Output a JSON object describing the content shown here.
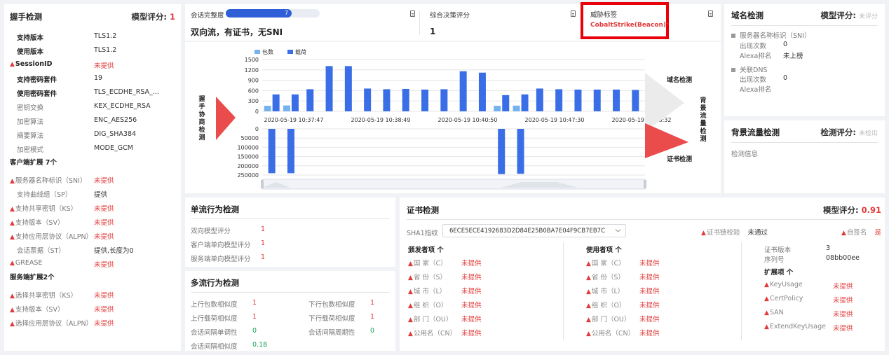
{
  "handshake": {
    "title": "握手检测",
    "score_label": "模型评分:",
    "score_value": "1",
    "rows": [
      {
        "label": "支持版本",
        "value": "TLS1.2",
        "style": "bold",
        "warn": false
      },
      {
        "label": "使用版本",
        "value": "TLS1.2",
        "style": "bold",
        "warn": false
      },
      {
        "label": "SessionID",
        "value": "未提供",
        "style": "bold",
        "warn": true
      },
      {
        "label": "支持密码套件",
        "value": "19",
        "style": "bold",
        "warn": false
      },
      {
        "label": "使用密码套件",
        "value": "TLS_ECDHE_RSA_...",
        "style": "bold",
        "warn": false
      },
      {
        "label": "密钥交换",
        "value": "KEX_ECDHE_RSA",
        "style": "light",
        "warn": false
      },
      {
        "label": "加密算法",
        "value": "ENC_AES256",
        "style": "light",
        "warn": false
      },
      {
        "label": "摘要算法",
        "value": "DIG_SHA384",
        "style": "light",
        "warn": false
      },
      {
        "label": "加密模式",
        "value": "MODE_GCM",
        "style": "light",
        "warn": false
      }
    ],
    "client_ext_title": "客户端扩展 7个",
    "client_ext": [
      {
        "label": "服务器名称标识（SNI）",
        "value": "未提供",
        "warn": true
      },
      {
        "label": "支持曲线组（SP）",
        "value": "提供",
        "warn": false
      },
      {
        "label": "支持共享密钥（KS）",
        "value": "未提供",
        "warn": true
      },
      {
        "label": "支持版本（SV）",
        "value": "未提供",
        "warn": true
      },
      {
        "label": "支持应用层协议（ALPN）",
        "value": "未提供",
        "warn": true
      },
      {
        "label": "会话票据（ST）",
        "value": "提供,长度为0",
        "warn": false
      },
      {
        "label": "GREASE",
        "value": "未提供",
        "warn": true
      }
    ],
    "server_ext_title": "服务端扩展2个",
    "server_ext": [
      {
        "label": "选择共享密钥（KS）",
        "value": "未提供",
        "warn": true
      },
      {
        "label": "支持版本（SV）",
        "value": "未提供",
        "warn": true
      },
      {
        "label": "选择应用层协议（ALPN）",
        "value": "未提供",
        "warn": true
      }
    ]
  },
  "summary": {
    "completeness_label": "会话完整度",
    "completeness_value": "7",
    "completeness_fraction": 0.7,
    "flow_desc": "双向流，有证书，无SNI",
    "decision_label": "综合决策评分",
    "decision_value": "1",
    "threat_label": "威胁标签",
    "threat_value": "CobaltStrike(Beacon)",
    "threat_mark": "*"
  },
  "chart_data": {
    "type": "bar",
    "legend": [
      "包数",
      "载荷"
    ],
    "legend_colors": [
      "#74b3f0",
      "#3a6ee6"
    ],
    "x_ticks": [
      "2020-05-19 10:37:47",
      "2020-05-19 10:38:49",
      "2020-05-19 10:40:50",
      "2020-05-19 10:47:30",
      "2020-05-19 10:48:32"
    ],
    "upper_ticks": [
      "1500",
      "1200",
      "900",
      "600",
      "300",
      "0"
    ],
    "upper_ylim": [
      0,
      1500
    ],
    "upper_packets": [
      160,
      0,
      170,
      0,
      0,
      0,
      0,
      0,
      0,
      0,
      0,
      0,
      0,
      0,
      0,
      0,
      0,
      0,
      0,
      0,
      0,
      0,
      0,
      0,
      0,
      160,
      0,
      165,
      0,
      0,
      0,
      0,
      0,
      0,
      0,
      0,
      0,
      0,
      0,
      0,
      0,
      0,
      0
    ],
    "upper_payload": [
      490,
      0,
      0,
      490,
      0,
      0,
      0,
      0,
      0,
      0,
      0,
      0,
      0,
      0,
      0,
      0,
      0,
      0,
      0,
      0,
      0,
      0,
      0,
      0,
      0,
      0,
      0,
      0,
      0,
      0,
      0,
      0,
      0,
      0,
      0,
      0,
      0,
      0,
      0,
      0,
      0,
      0,
      0
    ],
    "upper_bars": [
      {
        "p": 160,
        "v": 490
      },
      {
        "p": 170,
        "v": 490
      },
      {
        "p": 0,
        "v": 640
      },
      {
        "p": 0,
        "v": 1310
      },
      {
        "p": 0,
        "v": 1310
      },
      {
        "p": 0,
        "v": 660
      },
      {
        "p": 0,
        "v": 640
      },
      {
        "p": 0,
        "v": 650
      },
      {
        "p": 0,
        "v": 630
      },
      {
        "p": 0,
        "v": 640
      },
      {
        "p": 0,
        "v": 1160
      },
      {
        "p": 0,
        "v": 1120
      },
      {
        "p": 160,
        "v": 470
      },
      {
        "p": 165,
        "v": 490
      },
      {
        "p": 0,
        "v": 660
      },
      {
        "p": 0,
        "v": 640
      },
      {
        "p": 0,
        "v": 630
      },
      {
        "p": 0,
        "v": 630
      },
      {
        "p": 0,
        "v": 630
      },
      {
        "p": 0,
        "v": 620
      }
    ],
    "lower_ticks": [
      "0",
      "50000",
      "100000",
      "150000",
      "200000",
      "250000"
    ],
    "lower_ylim": [
      0,
      250000
    ],
    "lower_bars": [
      240000,
      240000,
      245000,
      243000
    ],
    "left_label": "握手协商检测",
    "right_top_label": "域名检测",
    "right_mid_label": "背景流量检测",
    "right_bot_label": "证书检测"
  },
  "domain": {
    "title": "域名检测",
    "score_label": "模型评分:",
    "score_value": "未评分",
    "sni_title": "服务器名称标识（SNI）",
    "sni_count_label": "出现次数",
    "sni_count": "0",
    "sni_alexa_label": "Alexa排名",
    "sni_alexa": "未上榜",
    "dns_title": "关联DNS",
    "dns_count_label": "出现次数",
    "dns_count": "0",
    "dns_alexa_label": "Alexa排名"
  },
  "bg_traffic": {
    "title": "背景流量检测",
    "score_label": "检测评分:",
    "score_value": "未检出",
    "info": "检测信息"
  },
  "single_flow": {
    "title": "单流行为检测",
    "rows": [
      {
        "label": "双向模型评分",
        "value": "1"
      },
      {
        "label": "客户端单向模型评分",
        "value": "1"
      },
      {
        "label": "服务端单向模型评分",
        "value": "1"
      }
    ]
  },
  "multi_flow": {
    "title": "多流行为检测",
    "left": [
      {
        "label": "上行包数相似度",
        "value": "1",
        "color": "red"
      },
      {
        "label": "上行载荷相似度",
        "value": "1",
        "color": "red"
      },
      {
        "label": "会话间隔单调性",
        "value": "0",
        "color": "green"
      },
      {
        "label": "会话间隔相似度",
        "value": "0.18",
        "color": "green"
      }
    ],
    "right": [
      {
        "label": "下行包数相似度",
        "value": "1",
        "color": "red"
      },
      {
        "label": "下行载荷相似度",
        "value": "1",
        "color": "red"
      },
      {
        "label": "会话间隔周期性",
        "value": "0",
        "color": "green"
      }
    ]
  },
  "cert": {
    "title": "证书检测",
    "score_label": "模型评分:",
    "score_value": "0.91",
    "sha1_label": "SHA1指纹",
    "sha1_value": "6ECE5ECE4192683D2D84E25B0BA7E04F9CB7EB7C",
    "chain_label": "证书链校验",
    "chain_value": "未通过",
    "self_label": "自签名",
    "self_value": "是",
    "issuer_title": "颁发者项 个",
    "subject_title": "使用者项 个",
    "fields": [
      {
        "label": "国 家（C）",
        "value": "未提供"
      },
      {
        "label": "省 份（S）",
        "value": "未提供"
      },
      {
        "label": "城 市（L）",
        "value": "未提供"
      },
      {
        "label": "组 织（O）",
        "value": "未提供"
      },
      {
        "label": "部 门（OU）",
        "value": "未提供"
      },
      {
        "label": "公用名（CN）",
        "value": "未提供"
      }
    ],
    "version_label": "证书版本",
    "version_value": "3",
    "serial_label": "序列号",
    "serial_value": "08bb00ee",
    "ext_title": "扩展项 个",
    "ext": [
      {
        "label": "KeyUsage",
        "value": "未提供"
      },
      {
        "label": "CertPolicy",
        "value": "未提供"
      },
      {
        "label": "SAN",
        "value": "未提供"
      },
      {
        "label": "ExtendKeyUsage",
        "value": "未提供"
      }
    ]
  }
}
